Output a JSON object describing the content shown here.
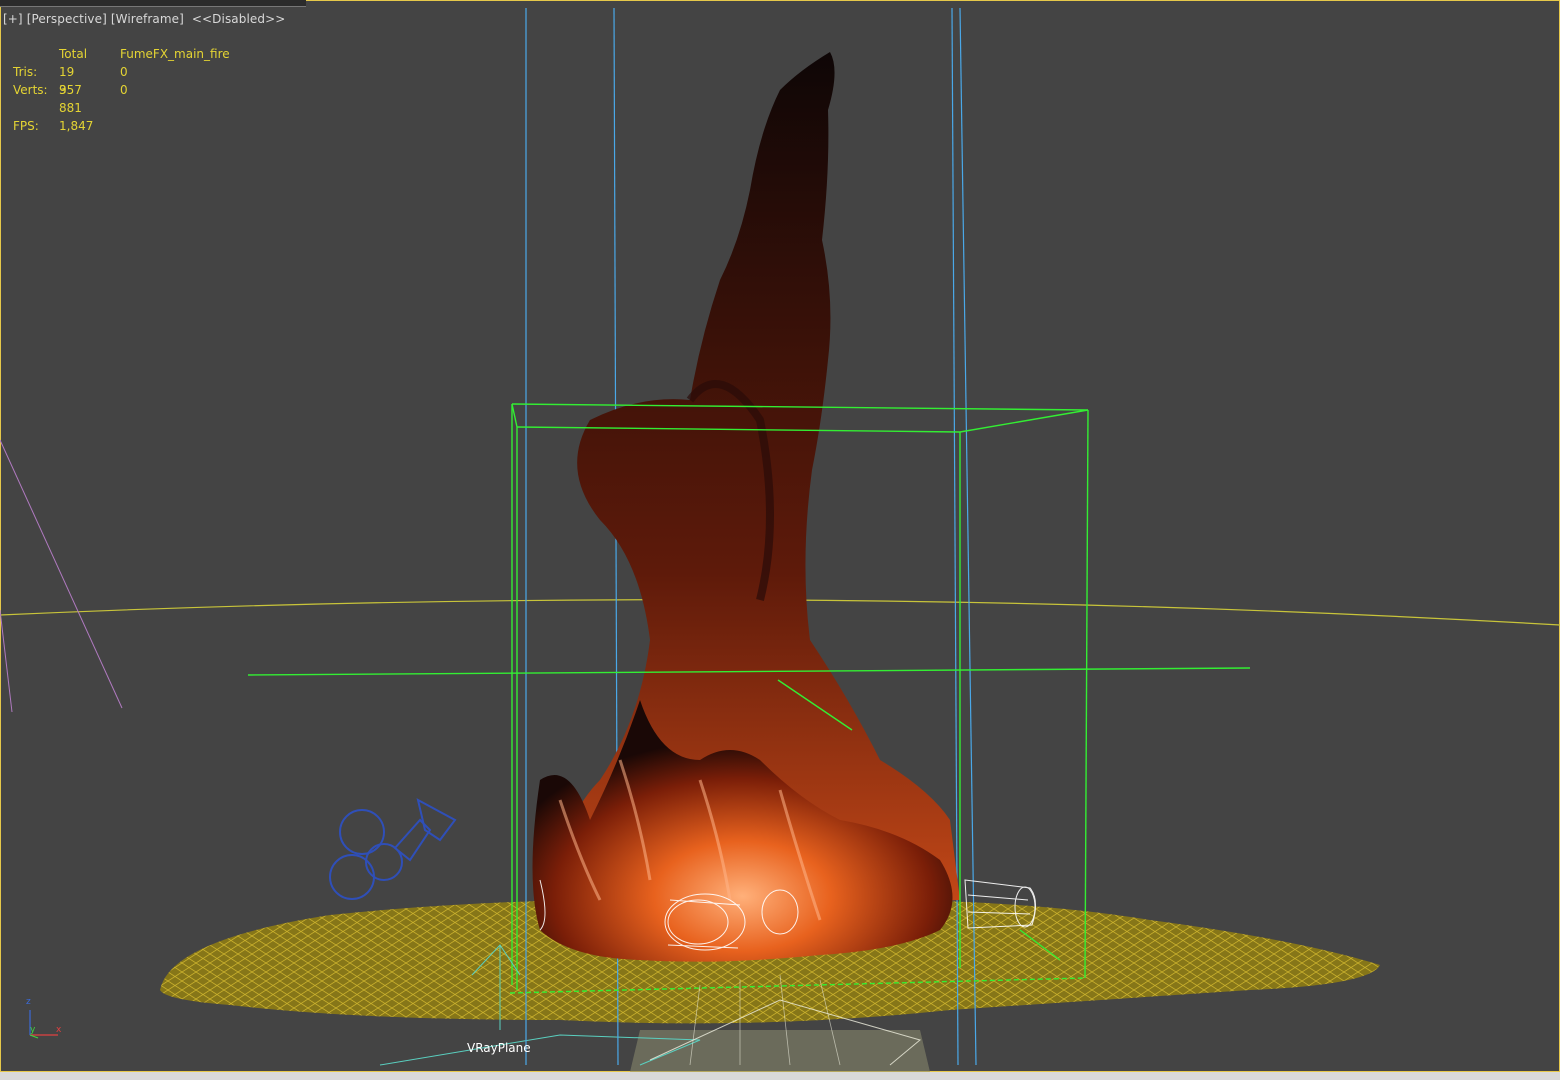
{
  "viewport": {
    "labels": [
      "[+]",
      "[Perspective]",
      "[Wireframe]",
      "<<Disabled>>"
    ]
  },
  "stats": {
    "header": [
      "",
      "Total",
      "FumeFX_main_fire"
    ],
    "rows": [
      {
        "label": "Tris:",
        "total": "19 357",
        "selected": "0"
      },
      {
        "label": "Verts:",
        "total": "9 881",
        "selected": "0"
      }
    ],
    "fps_label": "FPS:",
    "fps_value": "1,847"
  },
  "scene": {
    "object_label": "VRayPlane",
    "axis": {
      "z": "z",
      "y": "y",
      "x": "x"
    }
  },
  "colors": {
    "background": "#444444",
    "stats_text": "#e4d433",
    "bounding_box": "#33ee33",
    "fume_grid": "#4aa8e8",
    "ground_plane": "#b39a1c",
    "fire_core": "#e05a1c",
    "smoke": "#140a08"
  },
  "icons": [
    "camera-light-icon",
    "viewport-axis-gizmo-icon"
  ]
}
